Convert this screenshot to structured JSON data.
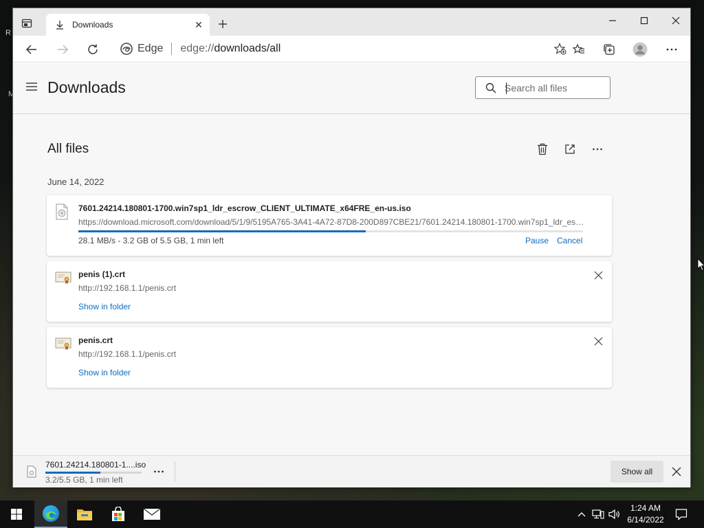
{
  "desktop": {
    "icon_text_top": "R",
    "icon_text_mid": "M"
  },
  "browser": {
    "tab_title": "Downloads",
    "address": {
      "site_name": "Edge",
      "url_prefix": "edge://",
      "url_path": "downloads/all"
    }
  },
  "downloads_page": {
    "title": "Downloads",
    "search_placeholder": "Search all files",
    "section_title": "All files",
    "date_group": "June 14, 2022",
    "items": [
      {
        "name": "7601.24214.180801-1700.win7sp1_ldr_escrow_CLIENT_ULTIMATE_x64FRE_en-us.iso",
        "url": "https://download.microsoft.com/download/5/1/9/5195A765-3A41-4A72-87D8-200D897CBE21/7601.24214.180801-1700.win7sp1_ldr_es…",
        "status": "28.1 MB/s - 3.2 GB of 5.5 GB, 1 min left",
        "progress": 0.57,
        "pause_label": "Pause",
        "cancel_label": "Cancel"
      },
      {
        "name": "penis (1).crt",
        "url": "http://192.168.1.1/penis.crt",
        "show_in_folder_label": "Show in folder"
      },
      {
        "name": "penis.crt",
        "url": "http://192.168.1.1/penis.crt",
        "show_in_folder_label": "Show in folder"
      }
    ]
  },
  "download_bar": {
    "file_name": "7601.24214.180801-1....iso",
    "status": "3.2/5.5 GB, 1 min left",
    "progress": 0.57,
    "show_all_label": "Show all"
  },
  "taskbar": {
    "time": "1:24 AM",
    "date": "6/14/2022"
  },
  "colors": {
    "accent": "#0f6cbd",
    "taskbar": "#101010"
  }
}
